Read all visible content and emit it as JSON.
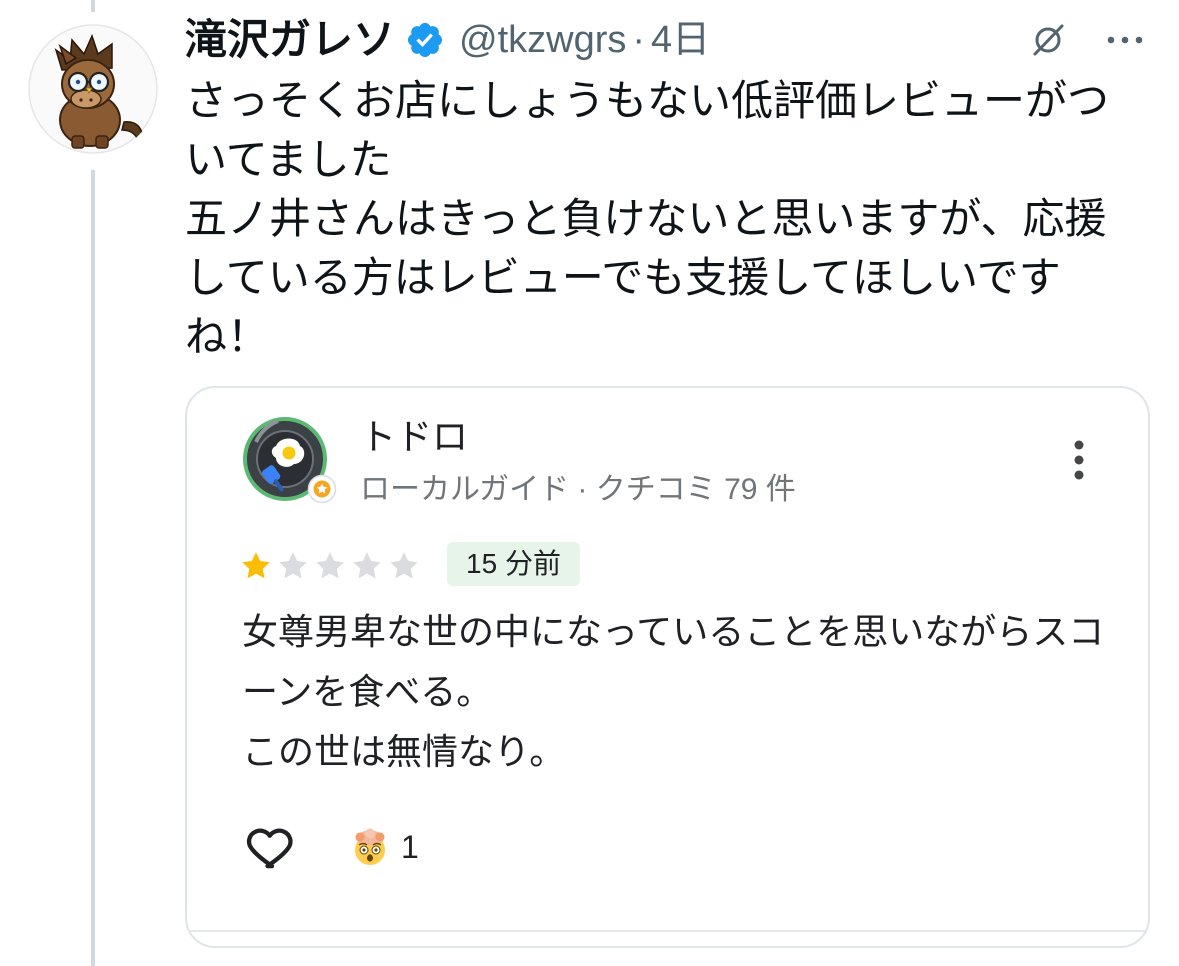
{
  "post": {
    "author_name": "滝沢ガレソ",
    "verified": true,
    "handle": "@tkzwgrs",
    "separator": "·",
    "time": "4日",
    "text_lines": [
      "さっそくお店にしょうもない低評価レビューがつ",
      "いてました",
      "五ノ井さんはきっと負けないと思いますが、応援",
      "している方はレビューでも支援してほしいです",
      "ね！"
    ]
  },
  "review": {
    "reviewer_name": "トドロ",
    "reviewer_meta": "ローカルガイド · クチコミ 79 件",
    "rating": 1,
    "max_rating": 5,
    "time_badge": "15 分前",
    "text_lines": [
      "女尊男卑な世の中になっていることを思いながらスコ",
      "ーンを食べる。",
      "この世は無情なり。"
    ],
    "reaction_count": "1"
  },
  "icons": {
    "verified": "verified-badge-icon",
    "grok": "grok-icon",
    "more": "more-horizontal-icon",
    "review_menu": "more-vertical-icon",
    "like": "heart-outline-icon",
    "reaction": "exploding-head-emoji",
    "local_guide": "local-guide-badge-icon"
  },
  "colors": {
    "text": "#0f1419",
    "secondary_text": "#536471",
    "verified": "#1d9bf0",
    "thread_line": "#cfd9de",
    "star_filled": "#fbbc04",
    "star_empty": "#dadce0",
    "time_badge_bg": "#e6f4ea",
    "avatar_ring": "#5bb974"
  }
}
